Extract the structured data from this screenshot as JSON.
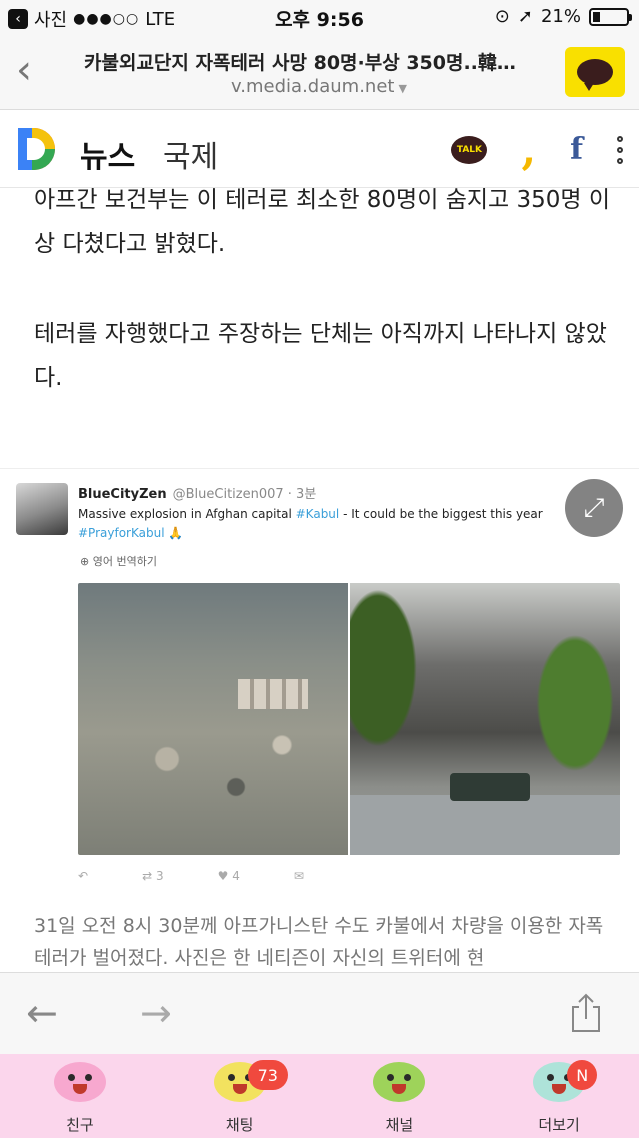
{
  "status_bar": {
    "back_app": "사진",
    "signal": "●●●○○",
    "network": "LTE",
    "time": "오후 9:56",
    "battery": "21%",
    "battery_level": 0.21
  },
  "url_bar": {
    "title": "카불외교단지 자폭테러 사망 80명·부상 350명..韓…",
    "domain": "v.media.daum.net"
  },
  "news_header": {
    "brand": "뉴스",
    "section": "국제",
    "talk_label": "TALK"
  },
  "article": {
    "paragraph_1": "아프간 보건부는 이 테러로 최소한 80명이 숨지고 350명 이상 다쳤다고 밝혔다.",
    "paragraph_2": "테러를 자행했다고 주장하는 단체는 아직까지 나타나지 않았다.",
    "caption": "31일 오전 8시 30분께 아프가니스탄 수도 카불에서 차량을 이용한 자폭테러가 벌어졌다. 사진은 한 네티즌이 자신의 트위터에 현"
  },
  "tweet": {
    "name": "BlueCityZen",
    "handle": "@BlueCitizen007 · 3분",
    "text_before_tag": "Massive explosion in Afghan capital ",
    "tag_1": "#Kabul",
    "text_after_tag": " - It could be the biggest this year",
    "tag_2": "#PrayforKabul 🙏",
    "translate": "영어 번역하기",
    "retweets": "3",
    "likes": "4"
  },
  "tab_bar": {
    "tabs": [
      {
        "label": "친구",
        "badge": "",
        "color": "#f7a8cf"
      },
      {
        "label": "채팅",
        "badge": "73",
        "color": "#f2e25f"
      },
      {
        "label": "채널",
        "badge": "",
        "color": "#9ed35a"
      },
      {
        "label": "더보기",
        "badge": "N",
        "color": "#aee3d9"
      }
    ]
  },
  "colors": {
    "kakao_yellow": "#f9e000",
    "tab_bar_bg": "#fbd6ec",
    "badge_red": "#f0493e",
    "twitter_blue": "#3a9fd9"
  }
}
